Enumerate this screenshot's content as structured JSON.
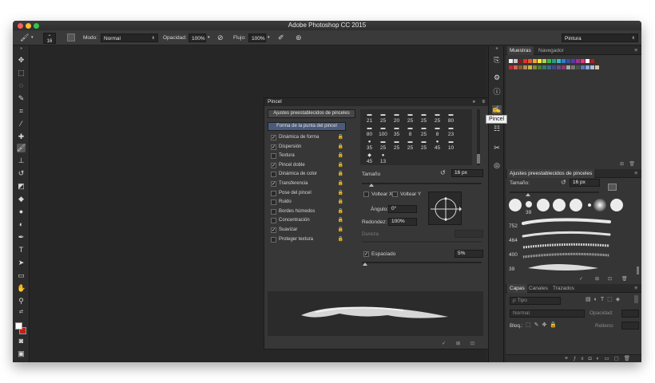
{
  "window": {
    "title": "Adobe Photoshop CC 2015"
  },
  "options_bar": {
    "brush_size": "16",
    "mode_label": "Modo:",
    "mode_value": "Normal",
    "opacity_label": "Opacidad:",
    "opacity_value": "100%",
    "flow_label": "Flujo:",
    "flow_value": "100%",
    "workspace_value": "Pintura"
  },
  "tooltip": {
    "text": "Pincel"
  },
  "brush_panel": {
    "title": "Pincel",
    "presets_button": "Ajustes preestablecidos de pinceles",
    "tip_shape_button": "Forma de la punta del pincel",
    "options": [
      {
        "label": "Dinámica de forma",
        "checked": "✓"
      },
      {
        "label": "Dispersión",
        "checked": "✓"
      },
      {
        "label": "Textura",
        "checked": ""
      },
      {
        "label": "Pincel doble",
        "checked": "✓"
      },
      {
        "label": "Dinámica de color",
        "checked": ""
      },
      {
        "label": "Transferencia",
        "checked": "✓"
      },
      {
        "label": "Pose del pincel",
        "checked": ""
      },
      {
        "label": "Ruido",
        "checked": ""
      },
      {
        "label": "Bordes húmedos",
        "checked": ""
      },
      {
        "label": "Concentración",
        "checked": ""
      },
      {
        "label": "Suavizar",
        "checked": "✓"
      },
      {
        "label": "Proteger textura",
        "checked": ""
      }
    ],
    "brush_sizes_row1": [
      "21",
      "25",
      "20",
      "25",
      "25",
      "25",
      "80"
    ],
    "brush_sizes_row2": [
      "80",
      "100",
      "35",
      "8",
      "25",
      "8",
      "23"
    ],
    "brush_sizes_row3": [
      "35",
      "25",
      "25",
      "25",
      "25",
      "45",
      "10"
    ],
    "brush_sizes_row4": [
      "45",
      "13"
    ],
    "size_label": "Tamaño",
    "size_value": "16 px",
    "flip_x": "Voltear X",
    "flip_y": "Voltear Y",
    "angle_label": "Ángulo:",
    "angle_value": "0°",
    "roundness_label": "Redondez:",
    "roundness_value": "100%",
    "hardness_label": "Dureza",
    "spacing_label": "Espaciado",
    "spacing_value": "5%"
  },
  "right_panel": {
    "swatches_tab": "Muestras",
    "navigator_tab": "Navegador",
    "swatch_colors": [
      "#f0f0f0",
      "#c8c8c8",
      "#8c1a1a",
      "#e03030",
      "#e35d2a",
      "#f2a53a",
      "#f7ea3c",
      "#a8d84a",
      "#44b24b",
      "#2a9e7a",
      "#3db8c8",
      "#2f7fcf",
      "#2f4fa8",
      "#5a3aa0",
      "#a02f9c",
      "#e8347a",
      "#ffffff",
      "#b01e1e",
      "#333333"
    ],
    "swatch_colors_row2": [
      "#c42a2a",
      "#d45f5f",
      "#8b5b2a",
      "#b38b5b",
      "#c8b44c",
      "#7d8c3a",
      "#4c7a3a",
      "#3a7a6a",
      "#3a6a8c",
      "#3a4a8c",
      "#6a4a8c",
      "#8c3a6a",
      "#a8a8a8",
      "#787878",
      "#505050",
      "#5a7ab8",
      "#8aa8d8",
      "#b0c0d8",
      "#d8c0a8"
    ],
    "brush_presets_title": "Ajustes preestablecidos de pinceles",
    "presets_size_label": "Tamaño:",
    "presets_size_value": "16 px",
    "preset_numbers": [
      "39",
      "752",
      "464",
      "400",
      "39"
    ],
    "layers_tab": "Capas",
    "channels_tab": "Canales",
    "paths_tab": "Trazados",
    "kind_filter": "ρ Tipo",
    "blend_mode": "Normal",
    "opacity_label": "Opacidad:",
    "lock_label": "Bloq.:",
    "fill_label": "Relleno:"
  },
  "colors": {
    "foreground": "#ffffff",
    "background": "#c0211c",
    "accent": "#4a5a7a"
  }
}
